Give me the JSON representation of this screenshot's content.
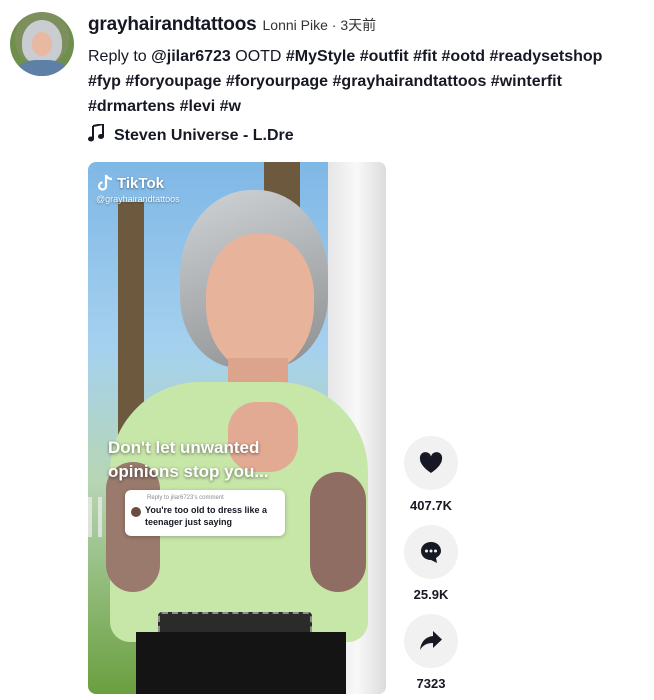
{
  "post": {
    "username": "grayhairandtattoos",
    "display_name": "Lonni Pike",
    "separator": "·",
    "time_ago": "3天前",
    "caption": {
      "reply_prefix": "Reply to ",
      "reply_handle": "@jilar6723",
      "text": " OOTD ",
      "hashtags": [
        "#MyStyle",
        "#outfit",
        "#fit",
        "#ootd",
        "#readysetshop",
        "#fyp",
        "#foryoupage",
        "#foryourpage",
        "#grayhairandtattoos",
        "#winterfit",
        "#drmartens",
        "#levi",
        "#w"
      ]
    },
    "music": "Steven Universe - L.Dre",
    "music_icon": "music-note-icon"
  },
  "video": {
    "watermark_logo": "TikTok",
    "watermark_handle": "@grayhairandtattoos",
    "overlay_text": "Don't let unwanted opinions stop you...",
    "reply_card": {
      "reply_to": "Reply to jilar6723's comment",
      "comment": "You're too old to dress like a teenager just saying"
    }
  },
  "actions": {
    "like": {
      "icon": "heart-icon",
      "count": "407.7K"
    },
    "comment": {
      "icon": "comment-icon",
      "count": "25.9K"
    },
    "share": {
      "icon": "share-icon",
      "count": "7323"
    }
  },
  "colors": {
    "text": "#161823",
    "button_bg": "#f1f1f2",
    "muted": "#8a8b91"
  }
}
